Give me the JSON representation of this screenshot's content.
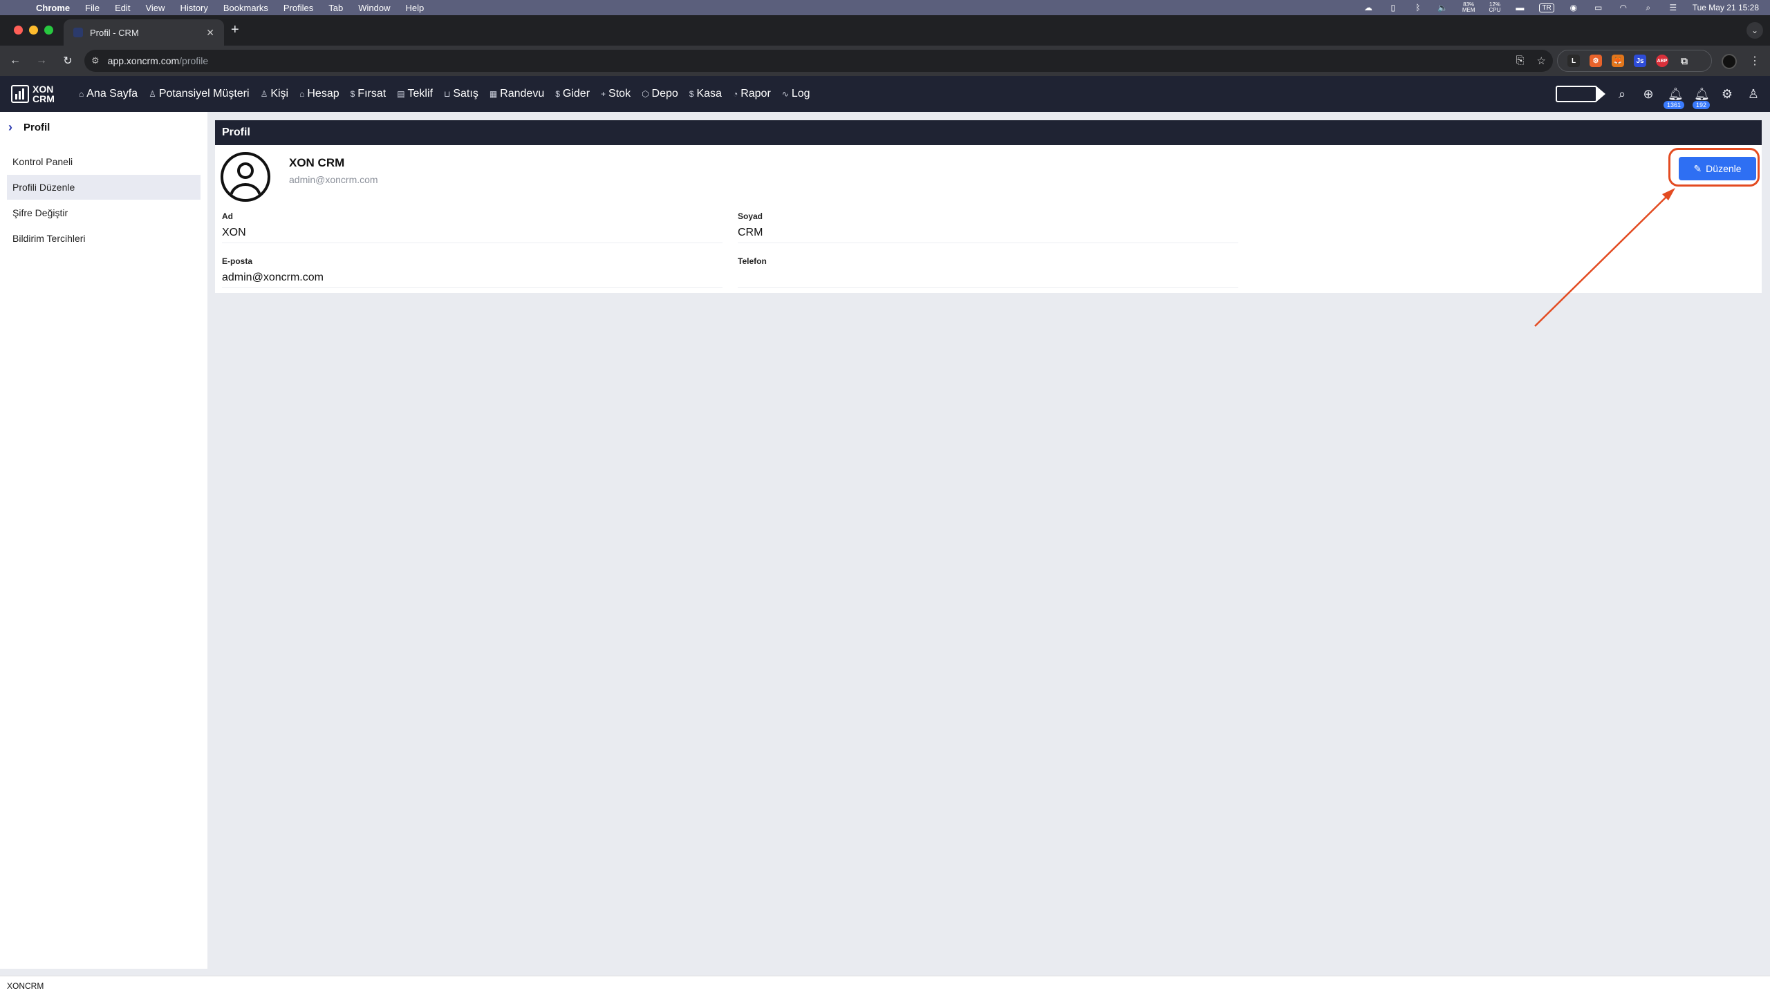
{
  "menubar": {
    "app": "Chrome",
    "items": [
      "File",
      "Edit",
      "View",
      "History",
      "Bookmarks",
      "Profiles",
      "Tab",
      "Window",
      "Help"
    ],
    "mem_value": "83%",
    "mem_label": "MEM",
    "cpu_value": "12%",
    "cpu_label": "CPU",
    "input_lang": "TR",
    "datetime": "Tue May 21  15:28"
  },
  "browser": {
    "tab_title": "Profil - CRM",
    "url_host": "app.xoncrm.com",
    "url_path": "/profile",
    "extensions": [
      {
        "icon": "L",
        "color": "#2a2a2a"
      },
      {
        "icon": "⚙",
        "color": "#e8632b"
      },
      {
        "icon": "🦊",
        "color": "#e2761b"
      },
      {
        "icon": "Js",
        "color": "#2e4cd8"
      },
      {
        "icon": "ABP",
        "color": "#d9303a"
      }
    ]
  },
  "app": {
    "logo_line1": "XON",
    "logo_line2": "CRM",
    "nav": [
      {
        "label": "Ana Sayfa",
        "icon": "⌂"
      },
      {
        "label": "Potansiyel Müşteri",
        "icon": "♙"
      },
      {
        "label": "Kişi",
        "icon": "♙"
      },
      {
        "label": "Hesap",
        "icon": "⌂"
      },
      {
        "label": "Fırsat",
        "icon": "$"
      },
      {
        "label": "Teklif",
        "icon": "▤"
      },
      {
        "label": "Satış",
        "icon": "⊔"
      },
      {
        "label": "Randevu",
        "icon": "▦"
      },
      {
        "label": "Gider",
        "icon": "$"
      },
      {
        "label": "Stok",
        "icon": "+"
      },
      {
        "label": "Depo",
        "icon": "⬡"
      },
      {
        "label": "Kasa",
        "icon": "$"
      },
      {
        "label": "Rapor",
        "icon": "◔"
      },
      {
        "label": "Log",
        "icon": "∿"
      }
    ],
    "badge_notifications": "1361",
    "badge_messages": "192"
  },
  "sidebar": {
    "title": "Profil",
    "items": [
      {
        "label": "Kontrol Paneli",
        "active": false
      },
      {
        "label": "Profili Düzenle",
        "active": true
      },
      {
        "label": "Şifre Değiştir",
        "active": false
      },
      {
        "label": "Bildirim Tercihleri",
        "active": false
      }
    ]
  },
  "profile": {
    "header": "Profil",
    "name": "XON CRM",
    "email": "admin@xoncrm.com",
    "edit_label": "Düzenle",
    "fields": {
      "first_name_label": "Ad",
      "first_name": "XON",
      "last_name_label": "Soyad",
      "last_name": "CRM",
      "email_label": "E-posta",
      "email": "admin@xoncrm.com",
      "phone_label": "Telefon",
      "phone": ""
    }
  },
  "statusbar": {
    "text": "XONCRM"
  },
  "colors": {
    "nav_bg": "#1f2333",
    "accent_button": "#2e6ff3",
    "annotation": "#e34b21",
    "page_bg": "#e9ebf0"
  }
}
